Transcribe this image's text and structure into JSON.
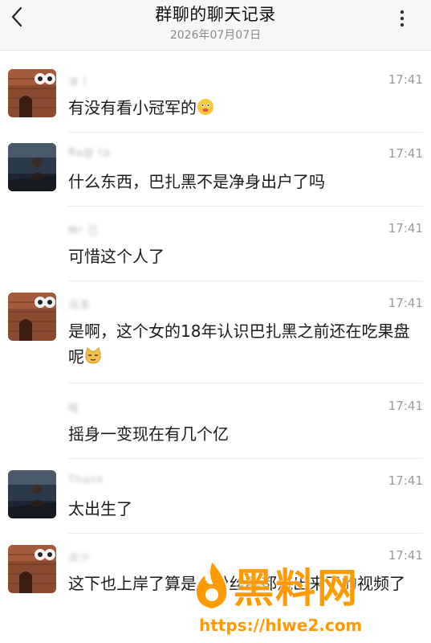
{
  "header": {
    "title": "群聊的聊天记录",
    "date": "2026年07月07日"
  },
  "messages": [
    {
      "nick": "冰丨",
      "time": "17:41",
      "text": "有没有看小冠军的",
      "avatar": "brick-building",
      "emoji": "smile-face-icon"
    },
    {
      "nick": "Ra@ ta",
      "time": "17:41",
      "text": "什么东西，巴扎黑不是净身出户了吗",
      "avatar": "person-on-boat",
      "emoji": null
    },
    {
      "nick": "Mr 已",
      "time": "17:41",
      "text": "可惜这个人了",
      "avatar": null,
      "emoji": null
    },
    {
      "nick": "冯多",
      "time": "17:41",
      "text": "是啊，这个女的18年认识巴扎黑之前还在吃果盘呢",
      "avatar": "brick-building",
      "emoji": "cat-face-icon"
    },
    {
      "nick": "哈",
      "time": "17:41",
      "text": "摇身一变现在有几个亿",
      "avatar": null,
      "emoji": null
    },
    {
      "nick": "Thank",
      "time": "17:41",
      "text": "太出生了",
      "avatar": "person-on-boat",
      "emoji": null
    },
    {
      "nick": "点少",
      "time": "17:41",
      "text": "这下也上岸了算是，粉丝群都流出来了的视频了",
      "avatar": "brick-building",
      "emoji": null
    }
  ],
  "watermark": {
    "brand": "黑料网",
    "url": "https://hlwe2.com"
  }
}
